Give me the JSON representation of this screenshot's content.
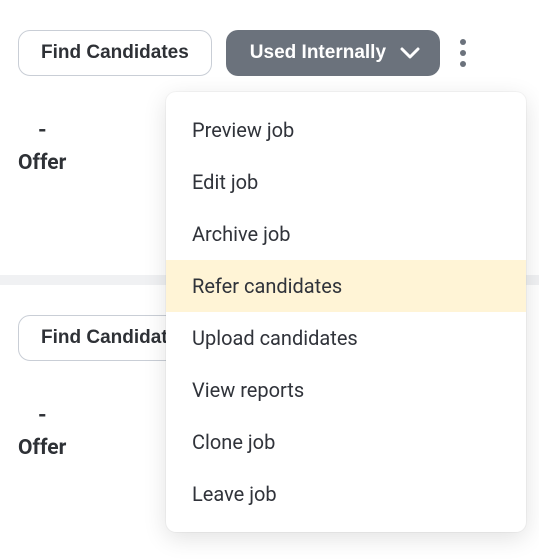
{
  "job1": {
    "find_btn": "Find Candidates",
    "status_btn": "Used Internally",
    "stage_count": "-",
    "stage_name": "Offer"
  },
  "job2": {
    "find_btn": "Find Candidates",
    "stage_count": "-",
    "stage_name": "Offer"
  },
  "menu": {
    "preview": "Preview job",
    "edit": "Edit job",
    "archive": "Archive job",
    "refer": "Refer candidates",
    "upload": "Upload candidates",
    "reports": "View reports",
    "clone": "Clone job",
    "leave": "Leave job"
  }
}
